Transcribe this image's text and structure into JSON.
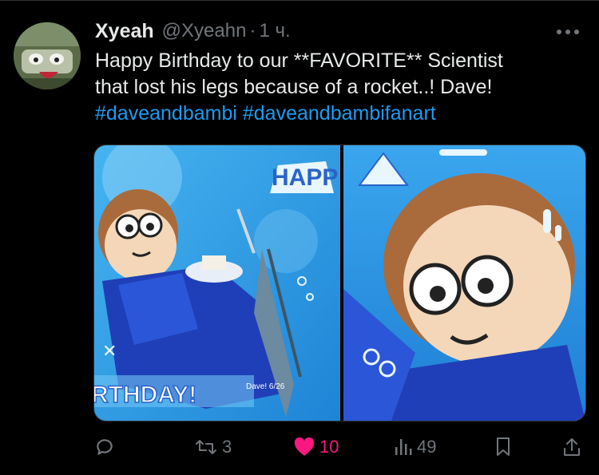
{
  "tweet": {
    "author_name": "Xyeah",
    "handle": "@Xyeahn",
    "separator": "·",
    "time": "1 ч.",
    "text_line1": "Happy Birthday to our **FAVORITE** Scientist",
    "text_line2": "that lost his legs because of a rocket..! Dave!",
    "hashtag1": "#daveandbambi",
    "hashtag2": "#daveandbambifanart"
  },
  "media": {
    "image1": {
      "banner_top": "HAPP",
      "banner_bottom": "RTHDAY!",
      "signature": "Dave! 6/26"
    },
    "image2": {}
  },
  "actions": {
    "reply": {
      "icon": "reply-icon",
      "count": ""
    },
    "retweet": {
      "icon": "retweet-icon",
      "count": "3"
    },
    "like": {
      "icon": "heart-icon",
      "count": "10",
      "active": true,
      "color": "#f91880"
    },
    "views": {
      "icon": "views-icon",
      "count": "49"
    },
    "bookmark": {
      "icon": "bookmark-icon"
    },
    "share": {
      "icon": "share-icon"
    }
  },
  "colors": {
    "background": "#000000",
    "text": "#e7e9ea",
    "muted": "#71767b",
    "link": "#1d9bf0",
    "like": "#f91880"
  }
}
